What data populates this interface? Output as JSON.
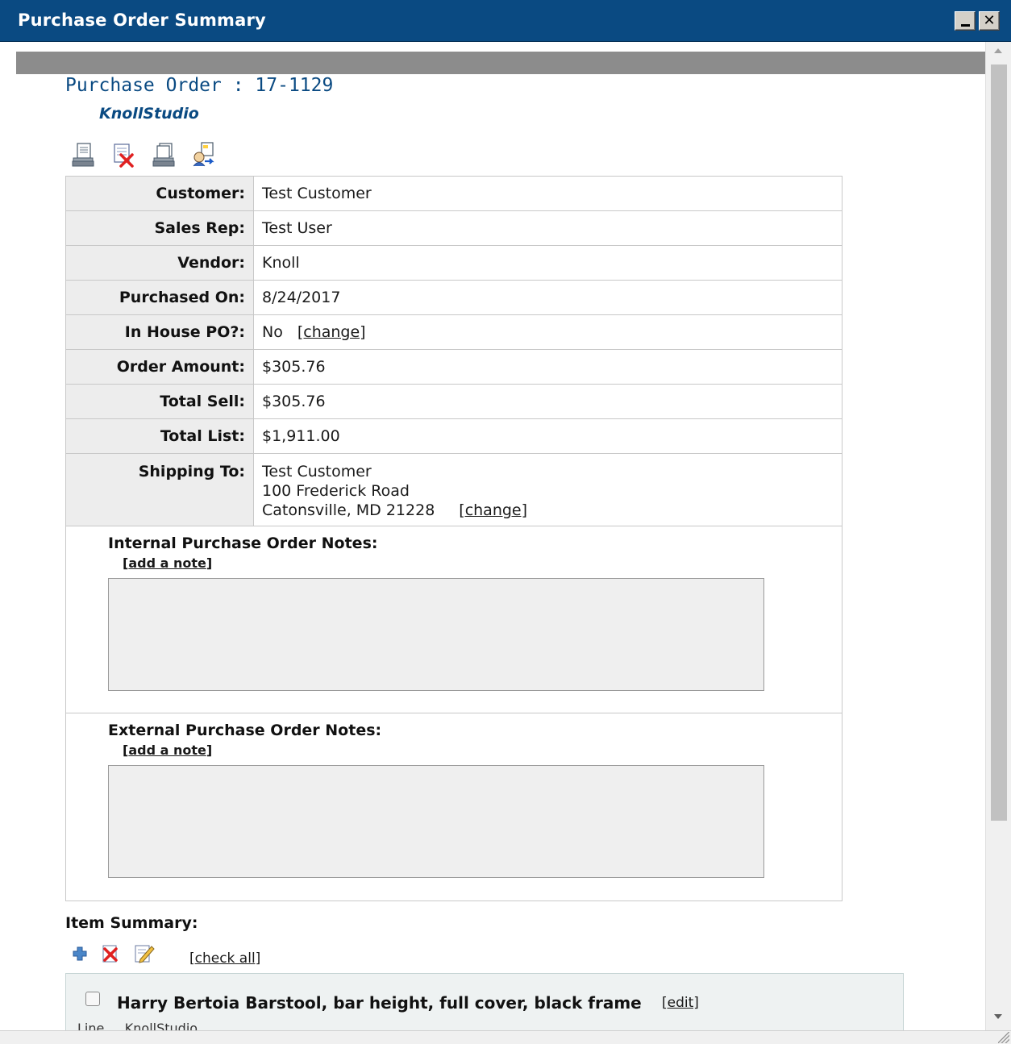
{
  "window": {
    "title": "Purchase Order Summary",
    "minimize_icon": "minimize-icon",
    "close_icon": "close-icon",
    "close_glyph": "✕"
  },
  "header": {
    "po_title": "Purchase Order : 17-1129",
    "vendor": "KnollStudio"
  },
  "toolbar": {
    "icons": [
      "print-icon",
      "delete-document-icon",
      "print-copy-icon",
      "send-document-icon"
    ]
  },
  "details": {
    "customer_label": "Customer:",
    "customer_value": "Test Customer",
    "sales_rep_label": "Sales Rep:",
    "sales_rep_value": "Test User",
    "vendor_label": "Vendor:",
    "vendor_value": "Knoll",
    "purchased_on_label": "Purchased On:",
    "purchased_on_value": "8/24/2017",
    "in_house_label": "In House PO?:",
    "in_house_value": "No",
    "in_house_change": "[change]",
    "order_amount_label": "Order Amount:",
    "order_amount_value": "$305.76",
    "total_sell_label": "Total Sell:",
    "total_sell_value": "$305.76",
    "total_list_label": "Total List:",
    "total_list_value": "$1,911.00",
    "shipping_label": "Shipping To:",
    "shipping_line1": "Test Customer",
    "shipping_line2": "100 Frederick Road",
    "shipping_line3": "Catonsville, MD 21228",
    "shipping_change": "[change]"
  },
  "notes": {
    "internal_label": "Internal Purchase Order Notes:",
    "internal_add_open": "[",
    "internal_add": "add a note",
    "internal_add_close": "]",
    "internal_value": "",
    "external_label": "External Purchase Order Notes:",
    "external_add_open": "[",
    "external_add": "add a note",
    "external_add_close": "]",
    "external_value": ""
  },
  "items": {
    "summary_label": "Item Summary:",
    "tool_icons": [
      "add-icon",
      "delete-icon",
      "edit-icon"
    ],
    "check_all": "[check all]",
    "list": [
      {
        "name": "Harry Bertoia Barstool, bar height, full cover, black frame",
        "edit": "[edit]",
        "checked": false,
        "subtext": "Line  ...  KnollStudio"
      }
    ]
  },
  "colors": {
    "title_bar": "#0a4a82",
    "accent_text": "#0a4a82",
    "label_bg": "#ededed"
  }
}
